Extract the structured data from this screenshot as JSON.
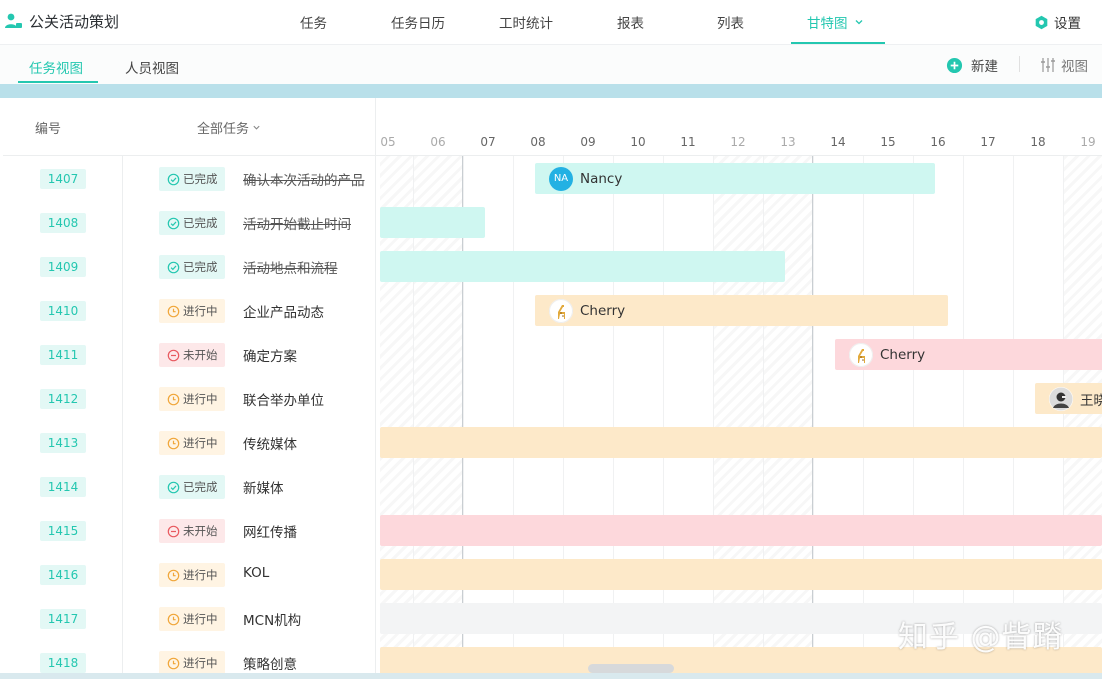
{
  "app": {
    "title": "公关活动策划"
  },
  "nav": {
    "items": [
      {
        "label": "任务"
      },
      {
        "label": "任务日历"
      },
      {
        "label": "工时统计"
      },
      {
        "label": "报表"
      },
      {
        "label": "列表"
      },
      {
        "label": "甘特图"
      }
    ],
    "active": "甘特图",
    "settings": "设置"
  },
  "subnav": {
    "tabs": [
      {
        "label": "任务视图"
      },
      {
        "label": "人员视图"
      }
    ],
    "active": "任务视图",
    "new_label": "新建",
    "view_label": "视图"
  },
  "table": {
    "col_id": "编号",
    "col_all": "全部任务",
    "rows": [
      {
        "id": "1407",
        "status": "已完成",
        "name": "确认本次活动的产品"
      },
      {
        "id": "1408",
        "status": "已完成",
        "name": "活动开始截止时间"
      },
      {
        "id": "1409",
        "status": "已完成",
        "name": "活动地点和流程"
      },
      {
        "id": "1410",
        "status": "进行中",
        "name": "企业产品动态"
      },
      {
        "id": "1411",
        "status": "未开始",
        "name": "确定方案"
      },
      {
        "id": "1412",
        "status": "进行中",
        "name": "联合举办单位"
      },
      {
        "id": "1413",
        "status": "进行中",
        "name": "传统媒体"
      },
      {
        "id": "1414",
        "status": "已完成",
        "name": "新媒体"
      },
      {
        "id": "1415",
        "status": "未开始",
        "name": "网红传播"
      },
      {
        "id": "1416",
        "status": "进行中",
        "name": "KOL"
      },
      {
        "id": "1417",
        "status": "进行中",
        "name": "MCN机构"
      },
      {
        "id": "1418",
        "status": "进行中",
        "name": "策略创意"
      }
    ]
  },
  "gantt": {
    "days": [
      "05",
      "06",
      "07",
      "08",
      "09",
      "10",
      "11",
      "12",
      "13",
      "14",
      "15",
      "16",
      "17",
      "18",
      "19"
    ],
    "bars": [
      {
        "row": 0,
        "assignee": "Nancy",
        "avatar_text": "NA"
      },
      {
        "row": 3,
        "assignee": "Cherry"
      },
      {
        "row": 4,
        "assignee": "Cherry"
      },
      {
        "row": 5,
        "assignee": "王晓"
      }
    ]
  },
  "watermark": "知乎 @眥蹐",
  "colors": {
    "accent": "#24c7b0",
    "done": "#cff7f1",
    "doing": "#fde9c9",
    "todo": "#fdd8dc"
  }
}
